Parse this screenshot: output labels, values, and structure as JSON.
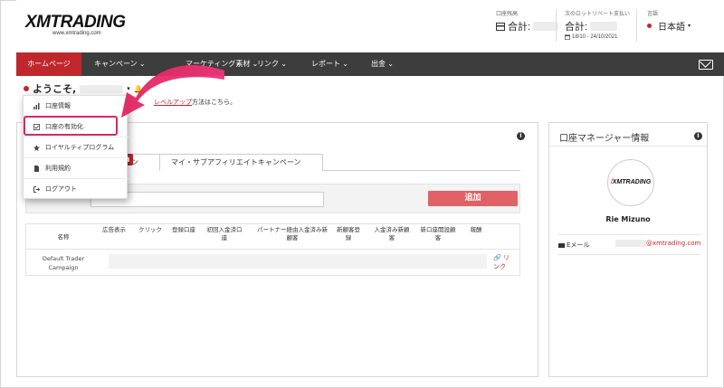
{
  "header": {
    "logo_text": "XMTRADING",
    "logo_url": "www.xmtrading.com",
    "account_type_label": "口座残高",
    "account_total_label": "合計:",
    "rebate_label": "次のロットリベート支払い",
    "rebate_total_label": "合計:",
    "rebate_period": "18/10 - 24/10/2021",
    "language_label": "言語",
    "language_value": "日本語"
  },
  "nav": {
    "items": [
      {
        "label": "ホームページ"
      },
      {
        "label": "キャンペーン"
      },
      {
        "label": "マーケティング素材"
      },
      {
        "label": "リンク"
      },
      {
        "label": "レポート"
      },
      {
        "label": "出金"
      }
    ]
  },
  "welcome": {
    "greeting": "ようこそ,",
    "note_prefix": "",
    "note_link": "レベルアップ",
    "note_suffix": "方法はこちら。"
  },
  "dropdown": {
    "items": [
      {
        "label": "口座情報",
        "icon": "chart-icon"
      },
      {
        "label": "口座の有効化",
        "icon": "checkbox-icon"
      },
      {
        "label": "ロイヤルティプログラム",
        "icon": "star-icon"
      },
      {
        "label": "利用規約",
        "icon": "document-icon"
      },
      {
        "label": "ログアウト",
        "icon": "logout-icon"
      }
    ]
  },
  "campaign": {
    "tabs": [
      {
        "label": "ン"
      },
      {
        "label": "マイ・サブアフィリエイトキャンペーン"
      }
    ],
    "add_button": "追加",
    "columns": [
      "名称",
      "広告表示",
      "クリック",
      "登録口座",
      "初回入金済口座",
      "パートナー経由入金済み新顧客",
      "新顧客登録",
      "入金済み新顧客",
      "新口座開設顧客",
      "報酬"
    ],
    "rows": [
      {
        "name": "Default Trader Campaign",
        "link_label": "リンク"
      }
    ]
  },
  "manager": {
    "title": "口座マネージャー情報",
    "logo_text": "XMTRADING",
    "name": "Rie Mizuno",
    "email_label": "Eメール",
    "email_value": "@xmtrading.com"
  },
  "colors": {
    "brand_red": "#c0272d",
    "nav_dark": "#3d3d3d",
    "highlight": "#e0245e"
  }
}
